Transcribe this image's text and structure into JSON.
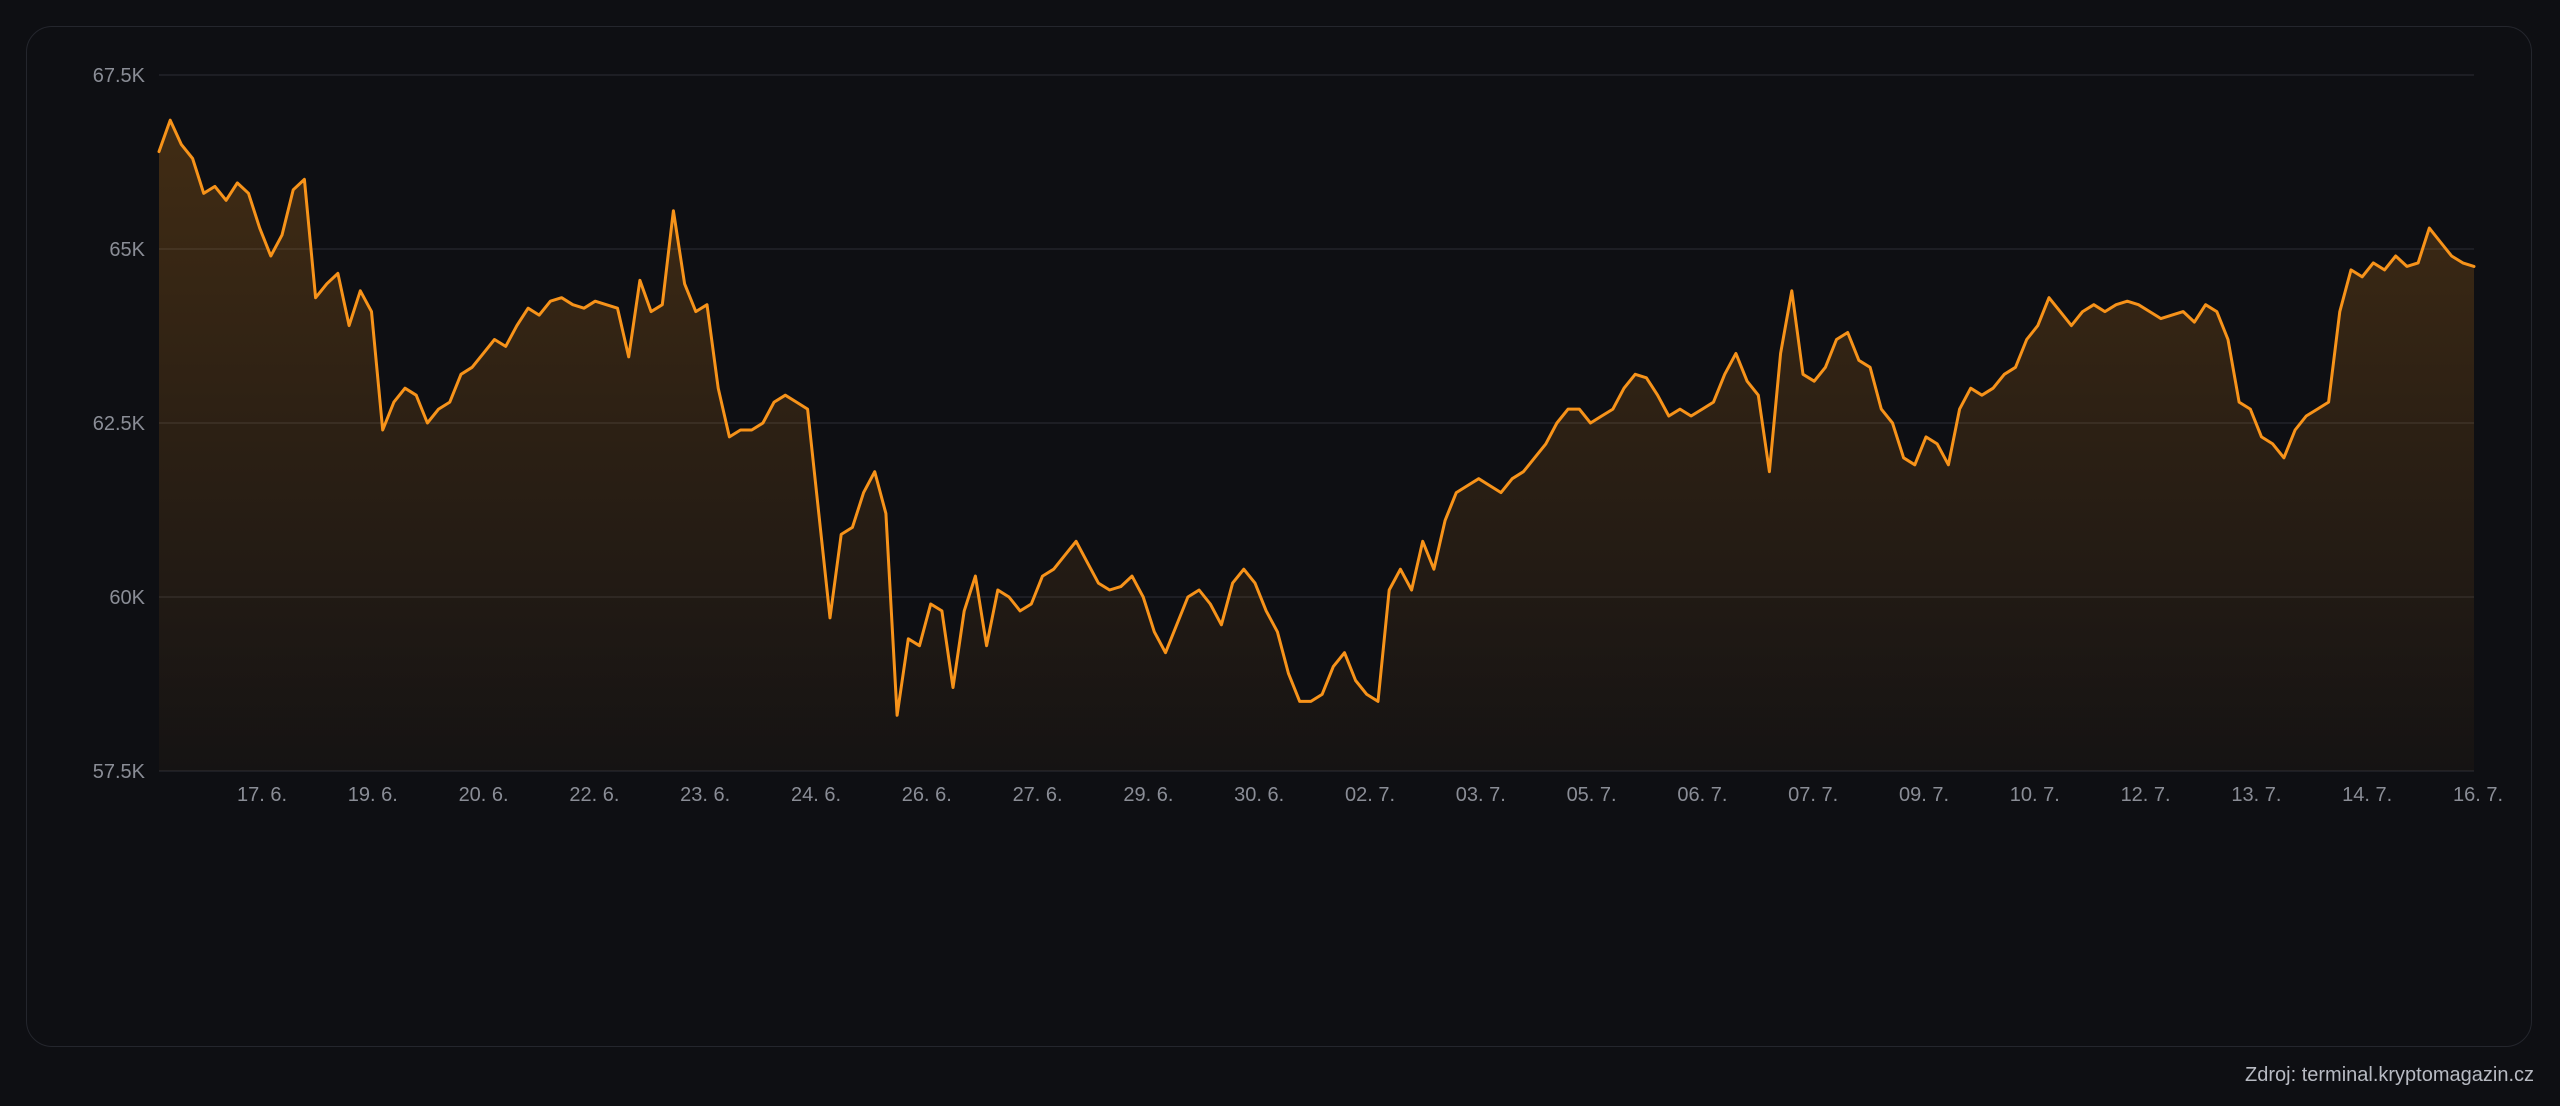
{
  "chart_data": {
    "type": "area",
    "title": "",
    "xlabel": "",
    "ylabel": "",
    "ylim": [
      57500,
      67500
    ],
    "grid": true,
    "y_ticks": [
      {
        "value": 57500,
        "label": "57.5K"
      },
      {
        "value": 60000,
        "label": "60K"
      },
      {
        "value": 62500,
        "label": "62.5K"
      },
      {
        "value": 65000,
        "label": "65K"
      },
      {
        "value": 67500,
        "label": "67.5K"
      }
    ],
    "x_tick_labels": [
      "17. 6.",
      "19. 6.",
      "20. 6.",
      "22. 6.",
      "23. 6.",
      "24. 6.",
      "26. 6.",
      "27. 6.",
      "29. 6.",
      "30. 6.",
      "02. 7.",
      "03. 7.",
      "05. 7.",
      "06. 7.",
      "07. 7.",
      "09. 7.",
      "10. 7.",
      "12. 7.",
      "13. 7.",
      "14. 7.",
      "16. 7."
    ],
    "series": [
      {
        "x_range": [
          0,
          20.9
        ],
        "values": [
          66400,
          66850,
          66500,
          66300,
          65800,
          65900,
          65700,
          65950,
          65800,
          65300,
          64900,
          65200,
          65850,
          66000,
          64300,
          64500,
          64650,
          63900,
          64400,
          64100,
          62400,
          62800,
          63000,
          62900,
          62500,
          62700,
          62800,
          63200,
          63300,
          63500,
          63700,
          63600,
          63900,
          64150,
          64050,
          64250,
          64300,
          64200,
          64150,
          64250,
          64200,
          64150,
          63450,
          64550,
          64100,
          64200,
          65550,
          64500,
          64100,
          64200,
          63000,
          62300,
          62400,
          62400,
          62500,
          62800,
          62900,
          62800,
          62700,
          61200,
          59700,
          60900,
          61000,
          61500,
          61800,
          61200,
          58300,
          59400,
          59300,
          59900,
          59800,
          58700,
          59800,
          60300,
          59300,
          60100,
          60000,
          59800,
          59900,
          60300,
          60400,
          60600,
          60800,
          60500,
          60200,
          60100,
          60150,
          60300,
          60000,
          59500,
          59200,
          59600,
          60000,
          60100,
          59900,
          59600,
          60200,
          60400,
          60200,
          59800,
          59500,
          58900,
          58500,
          58500,
          58600,
          59000,
          59200,
          58800,
          58600,
          58500,
          60100,
          60400,
          60100,
          60800,
          60400,
          61100,
          61500,
          61600,
          61700,
          61600,
          61500,
          61700,
          61800,
          62000,
          62200,
          62500,
          62700,
          62700,
          62500,
          62600,
          62700,
          63000,
          63200,
          63150,
          62900,
          62600,
          62700,
          62600,
          62700,
          62800,
          63200,
          63500,
          63100,
          62900,
          61800,
          63500,
          64400,
          63200,
          63100,
          63300,
          63700,
          63800,
          63400,
          63300,
          62700,
          62500,
          62000,
          61900,
          62300,
          62200,
          61900,
          62700,
          63000,
          62900,
          63000,
          63200,
          63300,
          63700,
          63900,
          64300,
          64100,
          63900,
          64100,
          64200,
          64100,
          64200,
          64250,
          64200,
          64100,
          64000,
          64050,
          64100,
          63950,
          64200,
          64100,
          63700,
          62800,
          62700,
          62300,
          62200,
          62000,
          62400,
          62600,
          62700,
          62800,
          64100,
          64700,
          64600,
          64800,
          64700,
          64900,
          64750,
          64800,
          65300,
          65100,
          64900,
          64800,
          64750
        ]
      }
    ]
  },
  "colors": {
    "line": "#f7931a",
    "grid": "#22242a",
    "background": "#0e0f13",
    "axis_text": "#8a8d96"
  },
  "source_text": "Zdroj: terminal.kryptomagazin.cz"
}
